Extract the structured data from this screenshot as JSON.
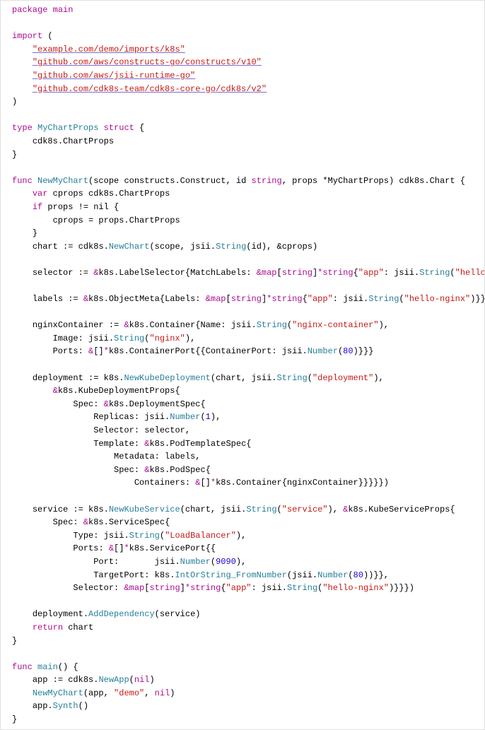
{
  "code_tokens": {
    "package": "package",
    "main": "main",
    "import": "import",
    "imp1": "\"example.com/demo/imports/k8s\"",
    "imp2": "\"github.com/aws/constructs-go/constructs/v10\"",
    "imp3": "\"github.com/aws/jsii-runtime-go\"",
    "imp4": "\"github.com/cdk8s-team/cdk8s-core-go/cdk8s/v2\"",
    "type": "type",
    "struct": "struct",
    "MyChartProps": "MyChartProps",
    "cdk8s_ChartProps": "cdk8s.ChartProps",
    "func": "func",
    "NewMyChart": "NewMyChart",
    "scope": "scope",
    "constructs_Construct": "constructs.Construct",
    "id": "id",
    "string": "string",
    "props": "props",
    "star_MyChartProps": "*MyChartProps",
    "cdk8s_Chart": "cdk8s.Chart",
    "var": "var",
    "cprops": "cprops",
    "if": "if",
    "props_ne_nil": "props != nil",
    "cprops_assign": "cprops = props.ChartProps",
    "chart": "chart",
    "NewChart": "NewChart",
    "jsii_String": "String",
    "amp_cprops": "&cprops",
    "selector": "selector",
    "LabelSelector": "LabelSelector",
    "MatchLabels": "MatchLabels",
    "map": "map",
    "star_string": "*string",
    "app_key": "\"app\"",
    "hello_nginx": "\"hello-nginx\"",
    "labels": "labels",
    "ObjectMeta": "ObjectMeta",
    "Labels": "Labels",
    "nginxContainer": "nginxContainer",
    "Container": "Container",
    "Name": "Name",
    "nginx_container_str": "\"nginx-container\"",
    "Image": "Image",
    "nginx_str": "\"nginx\"",
    "Ports": "Ports",
    "ContainerPort": "ContainerPort",
    "ContainerPort_field": "ContainerPort",
    "Number": "Number",
    "n80": "80",
    "deployment": "deployment",
    "NewKubeDeployment": "NewKubeDeployment",
    "deployment_str": "\"deployment\"",
    "KubeDeploymentProps": "KubeDeploymentProps",
    "Spec": "Spec",
    "DeploymentSpec": "DeploymentSpec",
    "Replicas": "Replicas",
    "n1": "1",
    "Selector": "Selector",
    "Template": "Template",
    "PodTemplateSpec": "PodTemplateSpec",
    "Metadata": "Metadata",
    "PodSpec": "PodSpec",
    "Containers": "Containers",
    "service": "service",
    "NewKubeService": "NewKubeService",
    "service_str": "\"service\"",
    "KubeServiceProps": "KubeServiceProps",
    "ServiceSpec": "ServiceSpec",
    "Type": "Type",
    "LoadBalancer": "\"LoadBalancer\"",
    "ServicePort": "ServicePort",
    "Port": "Port",
    "n9090": "9090",
    "TargetPort": "TargetPort",
    "IntOrString_FromNumber": "IntOrString_FromNumber",
    "AddDependency": "AddDependency",
    "return": "return",
    "main_fn": "main",
    "app_var": "app",
    "NewApp": "NewApp",
    "nil": "nil",
    "demo_str": "\"demo\"",
    "Synth": "Synth",
    "k8s": "k8s",
    "cdk8s": "cdk8s",
    "jsii": "jsii"
  }
}
